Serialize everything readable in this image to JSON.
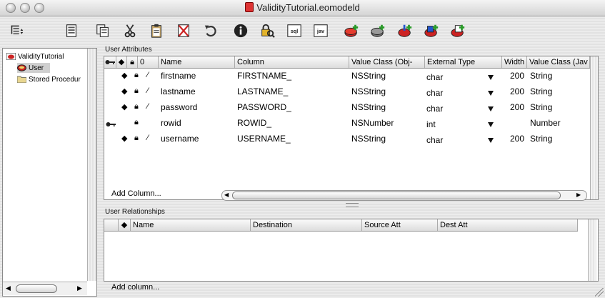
{
  "window": {
    "title": "ValidityTutorial.eomodeld",
    "controls": [
      "close-button",
      "minimize-button",
      "zoom-button"
    ]
  },
  "toolbar": {
    "buttons": [
      {
        "name": "outline-view-toggle",
        "icon": "outline-list-icon"
      },
      {
        "name": "new-entity",
        "icon": "new-document-icon"
      },
      {
        "name": "copy",
        "icon": "copy-icon"
      },
      {
        "name": "cut",
        "icon": "scissors-icon"
      },
      {
        "name": "paste",
        "icon": "clipboard-icon"
      },
      {
        "name": "delete",
        "icon": "delete-icon"
      },
      {
        "name": "undo",
        "icon": "undo-icon"
      },
      {
        "name": "inspector",
        "icon": "info-icon"
      },
      {
        "name": "validate",
        "icon": "lock-search-icon"
      },
      {
        "name": "generate-sql",
        "icon": "sql-icon",
        "text": "sql"
      },
      {
        "name": "generate-java",
        "icon": "java-icon",
        "text": "jav"
      },
      {
        "name": "add-entity",
        "icon": "add-entity-icon"
      },
      {
        "name": "add-attribute",
        "icon": "add-attribute-icon"
      },
      {
        "name": "add-relationship",
        "icon": "add-relationship-icon"
      },
      {
        "name": "add-fetch-spec",
        "icon": "add-fetch-spec-icon"
      },
      {
        "name": "add-stored-procedure",
        "icon": "add-stored-procedure-icon"
      }
    ]
  },
  "sidebar": {
    "items": [
      {
        "label": "ValidityTutorial",
        "icon": "model-icon",
        "selected": false
      },
      {
        "label": "User",
        "icon": "entity-icon",
        "selected": true
      },
      {
        "label": "Stored Procedur",
        "icon": "folder-icon",
        "selected": false
      }
    ]
  },
  "attributes": {
    "section_label": "User Attributes",
    "columns": [
      "0",
      "Name",
      "Column",
      "Value Class (Obj-",
      "External Type",
      "Width",
      "Value Class (Jav"
    ],
    "header_icons": [
      "key-icon",
      "diamond-icon",
      "lock-icon"
    ],
    "rows": [
      {
        "name": "firstname",
        "column": "FIRSTNAME_",
        "value_class_objc": "NSString",
        "external_type": "char",
        "width": "200",
        "value_class_java": "String",
        "primary_key": false,
        "class_property": true,
        "locking": true,
        "allows_null": true
      },
      {
        "name": "lastname",
        "column": "LASTNAME_",
        "value_class_objc": "NSString",
        "external_type": "char",
        "width": "200",
        "value_class_java": "String",
        "primary_key": false,
        "class_property": true,
        "locking": true,
        "allows_null": true
      },
      {
        "name": "password",
        "column": "PASSWORD_",
        "value_class_objc": "NSString",
        "external_type": "char",
        "width": "200",
        "value_class_java": "String",
        "primary_key": false,
        "class_property": true,
        "locking": true,
        "allows_null": true
      },
      {
        "name": "rowid",
        "column": "ROWID_",
        "value_class_objc": "NSNumber",
        "external_type": "int",
        "width": "",
        "value_class_java": "Number",
        "primary_key": true,
        "class_property": false,
        "locking": true,
        "allows_null": false
      },
      {
        "name": "username",
        "column": "USERNAME_",
        "value_class_objc": "NSString",
        "external_type": "char",
        "width": "200",
        "value_class_java": "String",
        "primary_key": false,
        "class_property": true,
        "locking": true,
        "allows_null": true
      }
    ],
    "add_column_label": "Add Column..."
  },
  "relationships": {
    "section_label": "User Relationships",
    "columns": [
      "Name",
      "Destination",
      "Source Att",
      "Dest Att"
    ],
    "header_icons": [
      "diamond-icon"
    ],
    "add_column_label": "Add column..."
  },
  "colors": {
    "selection_gray": "#cfcfcf",
    "toolbar_red": "#cc2222",
    "toolbar_green": "#2a9a2a",
    "toolbar_blue": "#2255cc"
  }
}
